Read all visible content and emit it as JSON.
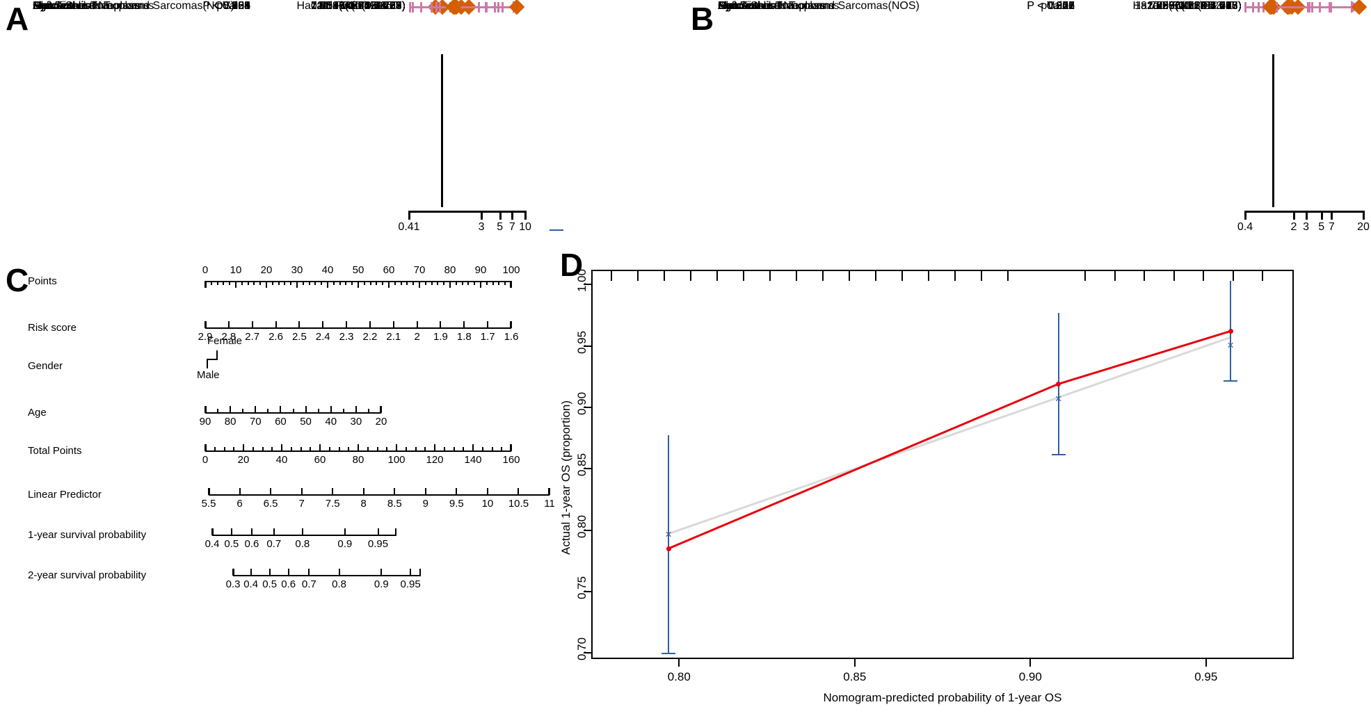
{
  "figure": {
    "panels": [
      "A",
      "B",
      "C",
      "D"
    ]
  },
  "panelA": {
    "letter": "A",
    "headers": {
      "characteristic": "Characteristic",
      "pvalue": "pValue",
      "hr": "Hazard Ratio(95% CI)"
    },
    "rows": [
      {
        "characteristic": "RiskScore",
        "pvalue": "P < 0.001",
        "hr": "7.966(3.345-18.97)",
        "est": 7.966,
        "lo": 3.345,
        "hi": 18.97,
        "clipped": true
      },
      {
        "characteristic": "Age",
        "pvalue": "0.004",
        "hr": "1.023(1.007-1.04)",
        "est": 1.023,
        "lo": 1.007,
        "hi": 1.04,
        "clipped": false
      },
      {
        "characteristic": "Gender",
        "pvalue": "0.438",
        "hr": "0.853(0.571-1.275)",
        "est": 0.853,
        "lo": 0.571,
        "hi": 1.275,
        "clipped": false
      },
      {
        "characteristic": "Lipomatous Neoplasms",
        "pvalue": "0.125",
        "hr": "1.718(0.861-3.427)",
        "est": 1.718,
        "lo": 0.861,
        "hi": 3.427,
        "clipped": false
      },
      {
        "characteristic": "Myomatous Neoplasms",
        "pvalue": "0.258",
        "hr": "1.451(0.762-2.763)",
        "est": 1.451,
        "lo": 0.762,
        "hi": 2.763,
        "clipped": false
      },
      {
        "characteristic": "Nerve Sheath Tumors",
        "pvalue": "0.535",
        "hr": "1.494(0.421-5.3)",
        "est": 1.494,
        "lo": 0.421,
        "hi": 5.3,
        "clipped": false
      },
      {
        "characteristic": "Soft Tissue Tumors and Sarcomas(NOS)",
        "pvalue": "0.063",
        "hr": "2.131(0.96-4.729)",
        "est": 2.131,
        "lo": 0.96,
        "hi": 4.729,
        "clipped": false
      },
      {
        "characteristic": "Synovial-like Neoplasms",
        "pvalue": "0.565",
        "hr": "1.395(0.449-4.33)",
        "est": 1.395,
        "lo": 0.449,
        "hi": 4.33,
        "clipped": false
      }
    ],
    "axis": {
      "ticks": [
        "0.41",
        "3",
        "5",
        "7",
        "10"
      ],
      "values": [
        0.41,
        3,
        5,
        7,
        10
      ],
      "scale": "log",
      "null_value": 1
    }
  },
  "panelB": {
    "letter": "B",
    "headers": {
      "characteristic": "Characteristic",
      "pvalue": "pValue",
      "hr": "Hazard Ratio(95% CI)"
    },
    "rows": [
      {
        "characteristic": "RiskScore",
        "pvalue": "P < 0.001",
        "hr": "18.755(6.435-54.668)",
        "est": 18.755,
        "lo": 6.435,
        "hi": 54.668,
        "clipped": true
      },
      {
        "characteristic": "Gender",
        "pvalue": "0.856",
        "hr": "0.96(0.62-1.486)",
        "est": 0.96,
        "lo": 0.62,
        "hi": 1.486,
        "clipped": false
      },
      {
        "characteristic": "Age",
        "pvalue": "P < 0.001",
        "hr": "1.029(1.012-1.047)",
        "est": 1.029,
        "lo": 1.012,
        "hi": 1.047,
        "clipped": false
      },
      {
        "characteristic": "Lipomatous Neoplasms",
        "pvalue": "0.022",
        "hr": "2.298(1.129-4.677)",
        "est": 2.298,
        "lo": 1.129,
        "hi": 4.677,
        "clipped": false
      },
      {
        "characteristic": "Myomatous Neoplasms",
        "pvalue": "0.111",
        "hr": "1.707(0.884-3.296)",
        "est": 1.707,
        "lo": 0.884,
        "hi": 3.296,
        "clipped": false
      },
      {
        "characteristic": "Nerve Sheath Tumors",
        "pvalue": "0.346",
        "hr": "1.857(0.513-6.726)",
        "est": 1.857,
        "lo": 0.513,
        "hi": 6.726,
        "clipped": false
      },
      {
        "characteristic": "Soft Tissue Tumors and Sarcomas(NOS)",
        "pvalue": "0.228",
        "hr": "1.635(0.735-3.633)",
        "est": 1.635,
        "lo": 0.735,
        "hi": 3.633,
        "clipped": false
      },
      {
        "characteristic": "Synovial-like Neoplasms",
        "pvalue": "0.877",
        "hr": "0.906(0.261-3.15)",
        "est": 0.906,
        "lo": 0.261,
        "hi": 3.15,
        "clipped": false
      }
    ],
    "axis": {
      "ticks": [
        "0.4",
        "2",
        "3",
        "5",
        "7",
        "20"
      ],
      "values": [
        0.4,
        2,
        3,
        5,
        7,
        20
      ],
      "scale": "log",
      "null_value": 1
    }
  },
  "panelC": {
    "letter": "C",
    "rows": [
      {
        "label": "Points",
        "type": "numeric",
        "major": [
          "0",
          "10",
          "20",
          "30",
          "40",
          "50",
          "60",
          "70",
          "80",
          "90",
          "100"
        ],
        "minor_per_gap": 4,
        "labels_above": true
      },
      {
        "label": "Risk score",
        "type": "numeric",
        "major": [
          "2.9",
          "2.8",
          "2.7",
          "2.6",
          "2.5",
          "2.4",
          "2.3",
          "2.2",
          "2.1",
          "2",
          "1.9",
          "1.8",
          "1.7",
          "1.6"
        ],
        "minor_per_gap": 0,
        "labels_above": false
      },
      {
        "label": "Gender",
        "type": "categorical",
        "categories": [
          "Female",
          "Male"
        ]
      },
      {
        "label": "Age",
        "type": "numeric",
        "major": [
          "90",
          "80",
          "70",
          "60",
          "50",
          "40",
          "30",
          "20"
        ],
        "minor_per_gap": 1,
        "labels_above": false
      },
      {
        "label": "Total Points",
        "type": "numeric",
        "major": [
          "0",
          "20",
          "40",
          "60",
          "80",
          "100",
          "120",
          "140",
          "160"
        ],
        "minor_per_gap": 3,
        "labels_above": false
      },
      {
        "label": "Linear Predictor",
        "type": "numeric",
        "major": [
          "5.5",
          "6",
          "6.5",
          "7",
          "7.5",
          "8",
          "8.5",
          "9",
          "9.5",
          "10",
          "10.5",
          "11"
        ],
        "minor_per_gap": 0,
        "labels_above": false
      },
      {
        "label": "1-year survival probability",
        "type": "nonlinear",
        "major": [
          "0.4",
          "0.5",
          "0.6",
          "0.7",
          "0.8",
          "0.9",
          "0.95"
        ],
        "positions": [
          0.0,
          0.105,
          0.215,
          0.335,
          0.49,
          0.72,
          0.9
        ],
        "labels_above": false
      },
      {
        "label": "2-year survival probability",
        "type": "nonlinear",
        "major": [
          "0.3",
          "0.4",
          "0.5",
          "0.6",
          "0.7",
          "0.8",
          "0.9",
          "0.95"
        ],
        "positions": [
          0.0,
          0.095,
          0.195,
          0.295,
          0.405,
          0.565,
          0.79,
          0.945
        ],
        "labels_above": false
      }
    ]
  },
  "panelD": {
    "letter": "D",
    "chart_data": {
      "type": "line",
      "title": "",
      "xlabel": "Nomogram-predicted probability of 1-year OS",
      "ylabel": "Actual 1-year OS (proportion)",
      "xlim": [
        0.775,
        0.975
      ],
      "ylim": [
        0.695,
        1.012
      ],
      "xticks": [
        "0.80",
        "0.85",
        "0.90",
        "0.95"
      ],
      "xtick_values": [
        0.8,
        0.85,
        0.9,
        0.95
      ],
      "yticks": [
        "0.70",
        "0.75",
        "0.80",
        "0.85",
        "0.90",
        "0.95",
        "1.00"
      ],
      "ytick_values": [
        0.7,
        0.75,
        0.8,
        0.85,
        0.9,
        0.95,
        1.0
      ],
      "grid": false,
      "legend": "none",
      "series": [
        {
          "name": "Ideal (reference diagonal)",
          "color": "#D9D9D9",
          "style": "solid",
          "x": [
            0.797,
            0.957
          ],
          "y": [
            0.797,
            0.957
          ]
        },
        {
          "name": "Bias-corrected (red)",
          "color": "#E8000B",
          "style": "solid",
          "x": [
            0.797,
            0.908,
            0.957
          ],
          "y": [
            0.785,
            0.919,
            0.962
          ]
        },
        {
          "name": "Apparent observed (blue X, with 95% CI)",
          "color": "#2E5FA3",
          "style": "points",
          "x": [
            0.797,
            0.908,
            0.957
          ],
          "y": [
            0.797,
            0.907,
            0.951
          ],
          "ci_low": [
            0.7,
            0.862,
            0.922
          ],
          "ci_high": [
            0.877,
            0.977,
            1.003
          ]
        }
      ],
      "markers": [
        {
          "shape": "circle",
          "color": "#E8000B",
          "x": 0.797,
          "y": 0.785
        },
        {
          "shape": "circle",
          "color": "#E8000B",
          "x": 0.908,
          "y": 0.919
        },
        {
          "shape": "circle",
          "color": "#E8000B",
          "x": 0.957,
          "y": 0.962
        },
        {
          "shape": "x",
          "color": "#2E5FA3",
          "x": 0.797,
          "y": 0.797
        },
        {
          "shape": "x",
          "color": "#2E5FA3",
          "x": 0.908,
          "y": 0.907
        },
        {
          "shape": "x",
          "color": "#2E5FA3",
          "x": 0.957,
          "y": 0.951
        }
      ]
    }
  },
  "colors": {
    "point": "#D55E00",
    "ci": "#CC79A7",
    "red_line": "#E8000B",
    "blue": "#2E5FA3",
    "grey_line": "#D9D9D9",
    "axis": "#000000"
  }
}
